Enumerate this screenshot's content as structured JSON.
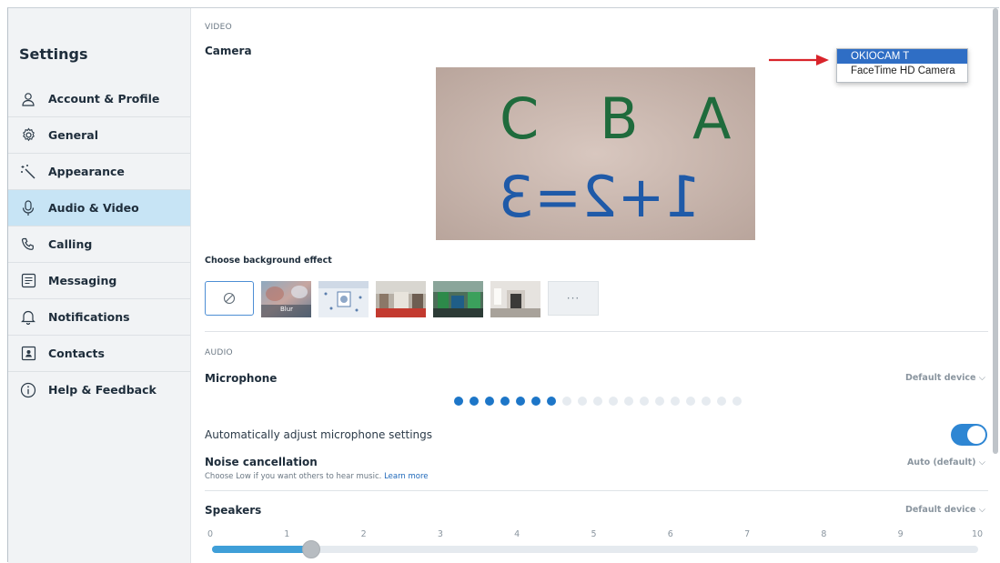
{
  "sidebar": {
    "title": "Settings",
    "items": [
      {
        "label": "Account & Profile",
        "icon": "person-icon"
      },
      {
        "label": "General",
        "icon": "gear-icon"
      },
      {
        "label": "Appearance",
        "icon": "magic-wand-icon"
      },
      {
        "label": "Audio & Video",
        "icon": "microphone-icon",
        "active": true
      },
      {
        "label": "Calling",
        "icon": "phone-icon"
      },
      {
        "label": "Messaging",
        "icon": "message-icon"
      },
      {
        "label": "Notifications",
        "icon": "bell-icon"
      },
      {
        "label": "Contacts",
        "icon": "contact-card-icon"
      },
      {
        "label": "Help & Feedback",
        "icon": "info-icon"
      }
    ]
  },
  "video": {
    "section": "VIDEO",
    "camera_label": "Camera",
    "camera_dropdown": {
      "options": [
        "OKIOCAM T",
        "FaceTime HD Camera"
      ],
      "selected": "OKIOCAM T"
    },
    "camera_preview_text": {
      "row1": [
        "C",
        "B",
        "A"
      ],
      "row2": "1+2=3"
    },
    "background_label": "Choose background effect",
    "blur_label": "Blur",
    "more_label": "···"
  },
  "audio": {
    "section": "AUDIO",
    "microphone_label": "Microphone",
    "microphone_device": "Default device",
    "mic_level_active": 7,
    "mic_level_total": 19,
    "auto_adjust_label": "Automatically adjust microphone settings",
    "auto_adjust_on": true,
    "noise_label": "Noise cancellation",
    "noise_value": "Auto (default)",
    "noise_hint": "Choose Low if you want others to hear music.",
    "noise_link": "Learn more",
    "speakers_label": "Speakers",
    "speakers_device": "Default device",
    "speaker_ticks": [
      "0",
      "1",
      "2",
      "3",
      "4",
      "5",
      "6",
      "7",
      "8",
      "9",
      "10"
    ],
    "speaker_volume": 1.3
  },
  "colors": {
    "accent": "#2e86d3",
    "active_nav": "#c7e4f5",
    "arrow": "#d9242b"
  }
}
